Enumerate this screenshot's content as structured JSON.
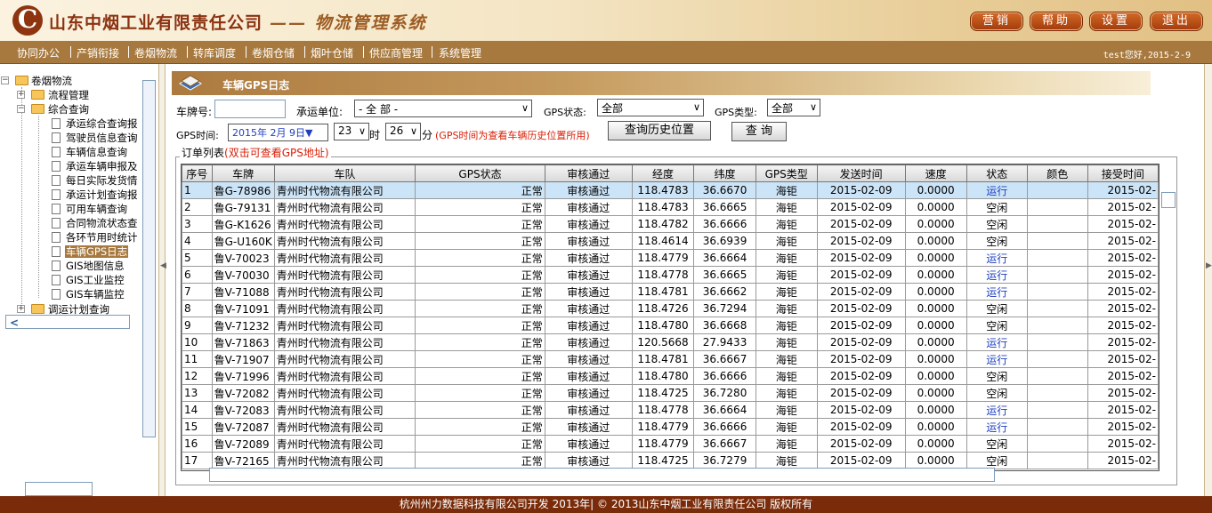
{
  "header": {
    "logo_letter": "C",
    "company_name": "山东中烟工业有限责任公司",
    "system_name": "—— 物流管理系统",
    "buttons": [
      "营销",
      "帮助",
      "设置",
      "退出"
    ]
  },
  "nav": {
    "items": [
      "协同办公",
      "产销衔接",
      "卷烟物流",
      "转库调度",
      "卷烟仓储",
      "烟叶仓储",
      "供应商管理",
      "系统管理"
    ],
    "welcome": "test您好,2015-2-9"
  },
  "tree": {
    "root": "卷烟物流",
    "nodes": [
      {
        "label": "流程管理",
        "type": "folder",
        "state": "+"
      },
      {
        "label": "综合查询",
        "type": "folder",
        "state": "-"
      },
      {
        "label": "承运综合查询报",
        "type": "doc"
      },
      {
        "label": "驾驶员信息查询",
        "type": "doc"
      },
      {
        "label": "车辆信息查询",
        "type": "doc"
      },
      {
        "label": "承运车辆申报及",
        "type": "doc"
      },
      {
        "label": "每日实际发货情",
        "type": "doc"
      },
      {
        "label": "承运计划查询报",
        "type": "doc"
      },
      {
        "label": "可用车辆查询",
        "type": "doc"
      },
      {
        "label": "合同物流状态查",
        "type": "doc"
      },
      {
        "label": "各环节用时统计",
        "type": "doc"
      },
      {
        "label": "车辆GPS日志",
        "type": "doc",
        "selected": true
      },
      {
        "label": "GIS地图信息",
        "type": "doc"
      },
      {
        "label": "GIS工业监控",
        "type": "doc"
      },
      {
        "label": "GIS车辆监控",
        "type": "doc"
      },
      {
        "label": "调运计划查询",
        "type": "folder",
        "state": "+"
      }
    ]
  },
  "panel": {
    "title": "车辆GPS日志",
    "plate_label": "车牌号:",
    "plate_value": "",
    "carrier_label": "承运单位:",
    "carrier_value": "- 全 部 -",
    "gps_state_label": "GPS状态:",
    "gps_state_value": "全部",
    "gps_type_label": "GPS类型:",
    "gps_type_value": "全部",
    "gps_time_label": "GPS时间:",
    "date_value": "2015年 2月 9日▼",
    "hour_value": "23",
    "hour_unit": "时",
    "minute_value": "26",
    "minute_unit": "分",
    "time_hint": "(GPS时间为查看车辆历史位置所用)",
    "history_button": "查询历史位置",
    "query_button": "查 询",
    "list_title": "订单列表",
    "list_hint": "(双击可查看GPS地址)"
  },
  "table": {
    "columns": [
      "序号",
      "车牌",
      "车队",
      "GPS状态",
      "审核通过",
      "经度",
      "纬度",
      "GPS类型",
      "发送时间",
      "速度",
      "状态",
      "颜色",
      "接受时间"
    ],
    "rows": [
      [
        "1",
        "鲁G-78986",
        "青州时代物流有限公司",
        "正常",
        "审核通过",
        "118.4783",
        "36.6670",
        "海钜",
        "2015-02-09",
        "0.0000",
        "运行",
        "",
        "2015-02-"
      ],
      [
        "2",
        "鲁G-79131",
        "青州时代物流有限公司",
        "正常",
        "审核通过",
        "118.4783",
        "36.6665",
        "海钜",
        "2015-02-09",
        "0.0000",
        "空闲",
        "",
        "2015-02-"
      ],
      [
        "3",
        "鲁G-K1626",
        "青州时代物流有限公司",
        "正常",
        "审核通过",
        "118.4782",
        "36.6666",
        "海钜",
        "2015-02-09",
        "0.0000",
        "空闲",
        "",
        "2015-02-"
      ],
      [
        "4",
        "鲁G-U160K",
        "青州时代物流有限公司",
        "正常",
        "审核通过",
        "118.4614",
        "36.6939",
        "海钜",
        "2015-02-09",
        "0.0000",
        "空闲",
        "",
        "2015-02-"
      ],
      [
        "5",
        "鲁V-70023",
        "青州时代物流有限公司",
        "正常",
        "审核通过",
        "118.4779",
        "36.6664",
        "海钜",
        "2015-02-09",
        "0.0000",
        "运行",
        "",
        "2015-02-"
      ],
      [
        "6",
        "鲁V-70030",
        "青州时代物流有限公司",
        "正常",
        "审核通过",
        "118.4778",
        "36.6665",
        "海钜",
        "2015-02-09",
        "0.0000",
        "运行",
        "",
        "2015-02-"
      ],
      [
        "7",
        "鲁V-71088",
        "青州时代物流有限公司",
        "正常",
        "审核通过",
        "118.4781",
        "36.6662",
        "海钜",
        "2015-02-09",
        "0.0000",
        "运行",
        "",
        "2015-02-"
      ],
      [
        "8",
        "鲁V-71091",
        "青州时代物流有限公司",
        "正常",
        "审核通过",
        "118.4726",
        "36.7294",
        "海钜",
        "2015-02-09",
        "0.0000",
        "空闲",
        "",
        "2015-02-"
      ],
      [
        "9",
        "鲁V-71232",
        "青州时代物流有限公司",
        "正常",
        "审核通过",
        "118.4780",
        "36.6668",
        "海钜",
        "2015-02-09",
        "0.0000",
        "空闲",
        "",
        "2015-02-"
      ],
      [
        "10",
        "鲁V-71863",
        "青州时代物流有限公司",
        "正常",
        "审核通过",
        "120.5668",
        "27.9433",
        "海钜",
        "2015-02-09",
        "0.0000",
        "运行",
        "",
        "2015-02-"
      ],
      [
        "11",
        "鲁V-71907",
        "青州时代物流有限公司",
        "正常",
        "审核通过",
        "118.4781",
        "36.6667",
        "海钜",
        "2015-02-09",
        "0.0000",
        "运行",
        "",
        "2015-02-"
      ],
      [
        "12",
        "鲁V-71996",
        "青州时代物流有限公司",
        "正常",
        "审核通过",
        "118.4780",
        "36.6666",
        "海钜",
        "2015-02-09",
        "0.0000",
        "空闲",
        "",
        "2015-02-"
      ],
      [
        "13",
        "鲁V-72082",
        "青州时代物流有限公司",
        "正常",
        "审核通过",
        "118.4725",
        "36.7280",
        "海钜",
        "2015-02-09",
        "0.0000",
        "空闲",
        "",
        "2015-02-"
      ],
      [
        "14",
        "鲁V-72083",
        "青州时代物流有限公司",
        "正常",
        "审核通过",
        "118.4778",
        "36.6664",
        "海钜",
        "2015-02-09",
        "0.0000",
        "运行",
        "",
        "2015-02-"
      ],
      [
        "15",
        "鲁V-72087",
        "青州时代物流有限公司",
        "正常",
        "审核通过",
        "118.4779",
        "36.6666",
        "海钜",
        "2015-02-09",
        "0.0000",
        "运行",
        "",
        "2015-02-"
      ],
      [
        "16",
        "鲁V-72089",
        "青州时代物流有限公司",
        "正常",
        "审核通过",
        "118.4779",
        "36.6667",
        "海钜",
        "2015-02-09",
        "0.0000",
        "空闲",
        "",
        "2015-02-"
      ],
      [
        "17",
        "鲁V-72165",
        "青州时代物流有限公司",
        "正常",
        "审核通过",
        "118.4725",
        "36.7279",
        "海钜",
        "2015-02-09",
        "0.0000",
        "空闲",
        "",
        "2015-02-"
      ]
    ]
  },
  "footer": {
    "text": "杭州州力数据科技有限公司开发 2013年| © 2013山东中烟工业有限责任公司 版权所有"
  },
  "colors": {
    "brand": "#8b3212",
    "nav_bg": "#a8793e",
    "footer_bg": "#7a2c0a",
    "running_status": "#1f3fbf",
    "hint_red": "#d81e06"
  }
}
